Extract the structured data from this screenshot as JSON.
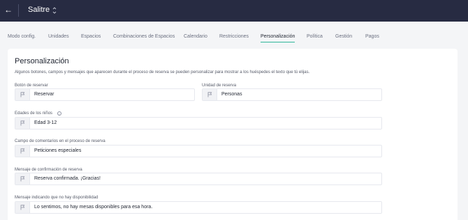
{
  "header": {
    "back_icon": "arrow-left-icon",
    "venue_name": "Salitre",
    "venue_selector_icon": "chevron-up-down-icon"
  },
  "tabs": [
    {
      "label": "Modo config."
    },
    {
      "label": "Unidades"
    },
    {
      "label": "Espacios"
    },
    {
      "label": "Combinaciones de Espacios"
    },
    {
      "label": "Calendario"
    },
    {
      "label": "Restricciones"
    },
    {
      "label": "Personalización",
      "active": true
    },
    {
      "label": "Política"
    },
    {
      "label": "Gestión"
    },
    {
      "label": "Pagos"
    }
  ],
  "section": {
    "title": "Personalización",
    "description": "Algunos botones, campos y mensajes que aparecen durante el proceso de reserva se pueden personalizar para mostrar a los huéspedes el texto que tú elijas."
  },
  "fields": {
    "boton_reservar": {
      "label": "Botón de reservar",
      "value": "Reservar"
    },
    "unidad_reserva": {
      "label": "Unidad de reserva",
      "value": "Personas"
    },
    "edades_ninos": {
      "label": "Edades de los niños",
      "value": "Edad 3-12",
      "info_icon": "info-icon"
    },
    "campo_comentarios": {
      "label": "Campo de comentarios en el proceso de reserva",
      "value": "Peticiones especiales"
    },
    "mensaje_confirmacion": {
      "label": "Mensaje de confirmación de reserva",
      "value": "Reserva confirmada. ¡Gracias!"
    },
    "mensaje_sin_disponibilidad": {
      "label": "Mensaje indicando que no hay disponibilidad",
      "value": "Lo sentimos, no hay mesas disponibles para esa hora."
    }
  },
  "field_icon": "flag-icon",
  "colors": {
    "header_bg": "#272b42",
    "accent": "#2fb79a",
    "page_bg": "#f4f5f7"
  }
}
